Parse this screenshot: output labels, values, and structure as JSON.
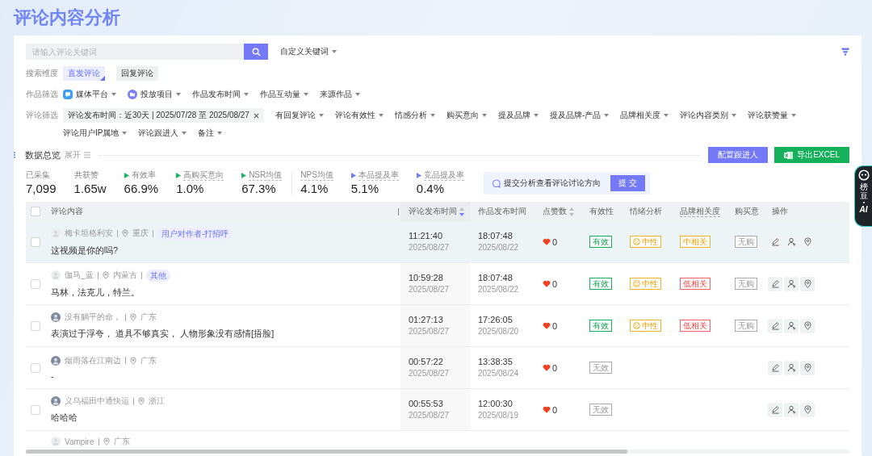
{
  "page": {
    "title": "评论内容分析"
  },
  "search": {
    "placeholder": "请输入评论关键词",
    "custom_keywords": "自定义关键词"
  },
  "filters": [
    {
      "label": "搜索维度",
      "items": [
        {
          "kind": "toggle",
          "text": "直发评论",
          "selected": true
        },
        {
          "kind": "toggle",
          "text": "回复评论",
          "selected": false
        }
      ]
    },
    {
      "label": "作品筛选",
      "items": [
        {
          "kind": "platform",
          "text": "媒体平台"
        },
        {
          "kind": "project",
          "text": "投放项目"
        },
        {
          "kind": "dropdown",
          "text": "作品发布时间"
        },
        {
          "kind": "dropdown",
          "text": "作品互动量"
        },
        {
          "kind": "dropdown",
          "text": "来源作品"
        }
      ]
    },
    {
      "label": "评论筛选",
      "items": [
        {
          "kind": "applied",
          "text": "评论发布时间：近30天 | 2025/07/28 至 2025/08/27"
        },
        {
          "kind": "dropdown",
          "text": "有回复评论"
        },
        {
          "kind": "dropdown",
          "text": "评论有效性"
        },
        {
          "kind": "dropdown",
          "text": "情感分析"
        },
        {
          "kind": "dropdown",
          "text": "购买意向"
        },
        {
          "kind": "dropdown",
          "text": "提及品牌"
        },
        {
          "kind": "dropdown",
          "text": "提及品牌-产品"
        },
        {
          "kind": "dropdown",
          "text": "品牌相关度"
        },
        {
          "kind": "dropdown",
          "text": "评论内容类别"
        },
        {
          "kind": "dropdown",
          "text": "评论获赞量"
        },
        {
          "kind": "dropdown",
          "text": "评论用户IP属地"
        },
        {
          "kind": "dropdown",
          "text": "评论跟进人"
        },
        {
          "kind": "dropdown",
          "text": "备注"
        }
      ]
    }
  ],
  "overview": {
    "title": "数据总览",
    "toggle": "展开",
    "buttons": [
      {
        "kind": "primary",
        "text": "配置跟进人"
      },
      {
        "kind": "excel",
        "text": "导出EXCEL"
      }
    ]
  },
  "stat_groups": [
    {
      "items": [
        {
          "label": "已采集",
          "value": "7,099",
          "hint": false
        },
        {
          "label": "共获赞",
          "value": "1.65w",
          "hint": false
        },
        {
          "label": "有效率",
          "value": "66.9%",
          "hint": false,
          "color": "#1db464"
        },
        {
          "label": "高购买意向",
          "value": "1.0%",
          "hint": true,
          "color": "#1db464"
        },
        {
          "label": "NSR均值",
          "value": "67.3%",
          "hint": true,
          "color": "#1db464"
        }
      ]
    },
    {
      "items": [
        {
          "label": "NPS均值",
          "value": "4.1%",
          "hint": true
        },
        {
          "label": "本品提及率",
          "value": "5.1%",
          "hint": true,
          "color": "#6f7cf6"
        },
        {
          "label": "竞品提及率",
          "value": "0.4%",
          "hint": true,
          "color": "#6f7cf6"
        }
      ]
    }
  ],
  "analysis": {
    "text": "提交分析查看评论讨论方向",
    "button": "提 交"
  },
  "table": {
    "select_all": {
      "checked": false
    },
    "columns": [
      {
        "title": "评论内容",
        "hint": false
      },
      {
        "title": "评论发布时间",
        "hint": false,
        "sorted_descending": true
      },
      {
        "title": "作品发布时间",
        "hint": false
      },
      {
        "title": "点赞数",
        "hint": false,
        "sorted_descending": false
      },
      {
        "title": "有效性",
        "hint": false
      },
      {
        "title": "情绪分析",
        "hint": false
      },
      {
        "title": "品牌相关度",
        "hint": true
      },
      {
        "title": "购买意",
        "hint": false
      },
      {
        "title": "操作",
        "hint": false
      }
    ],
    "rows": [
      {
        "hovered": true,
        "checked": false,
        "photo": false,
        "author": "梅卡坦格利安",
        "location": "重庆",
        "tag": "用户对作者-打招呼",
        "comment": "这视频是你的吗?",
        "comment_time": "11:21:40",
        "comment_date": "2025/08/27",
        "work_time": "18:07:48",
        "work_date": "2025/08/22",
        "likes": "0",
        "validity": {
          "text": "有效",
          "valid": true
        },
        "emotion": {
          "text": "中性",
          "kind": "neutral"
        },
        "relevance": {
          "text": "中相关",
          "kind": "medium"
        },
        "purchase": {
          "text": "无购"
        }
      },
      {
        "hovered": false,
        "checked": false,
        "photo": false,
        "author": "伽马_蓝",
        "location": "内蒙古",
        "tag": "其他",
        "comment": "马林，法克儿，特兰。",
        "comment_time": "10:59:28",
        "comment_date": "2025/08/27",
        "work_time": "18:07:48",
        "work_date": "2025/08/22",
        "likes": "0",
        "validity": {
          "text": "有效",
          "valid": true
        },
        "emotion": {
          "text": "中性",
          "kind": "neutral"
        },
        "relevance": {
          "text": "低相关",
          "kind": "low"
        },
        "purchase": {
          "text": "无购"
        }
      },
      {
        "hovered": false,
        "checked": false,
        "photo": true,
        "author": "没有躺平的命，",
        "location": "广东",
        "comment": "表演过于浮夸， 道具不够真实， 人物形象没有感情[捂脸]",
        "comment_time": "01:27:13",
        "comment_date": "2025/08/27",
        "work_time": "17:26:05",
        "work_date": "2025/08/20",
        "likes": "0",
        "validity": {
          "text": "有效",
          "valid": true
        },
        "emotion": {
          "text": "中性",
          "kind": "neutral"
        },
        "relevance": {
          "text": "低相关",
          "kind": "low"
        },
        "purchase": {
          "text": "无购"
        }
      },
      {
        "hovered": false,
        "checked": false,
        "photo": true,
        "author": "烟雨落在江南边",
        "location": "广东",
        "comment": "-",
        "comment_time": "00:57:22",
        "comment_date": "2025/08/27",
        "work_time": "13:38:35",
        "work_date": "2025/08/24",
        "likes": "0",
        "validity": {
          "text": "无效",
          "valid": false
        }
      },
      {
        "hovered": false,
        "checked": false,
        "photo": true,
        "author": "义乌福田中通快运",
        "location": "浙江",
        "comment": "哈哈哈",
        "comment_time": "00:55:53",
        "comment_date": "2025/08/27",
        "work_time": "12:00:30",
        "work_date": "2025/08/19",
        "likes": "0",
        "validity": {
          "text": "无效",
          "valid": false
        }
      },
      {
        "hovered": false,
        "photo": false,
        "author": "Vampire",
        "location": "广东"
      }
    ]
  },
  "assistant": {
    "name": "榜豆",
    "badge": "AI"
  }
}
